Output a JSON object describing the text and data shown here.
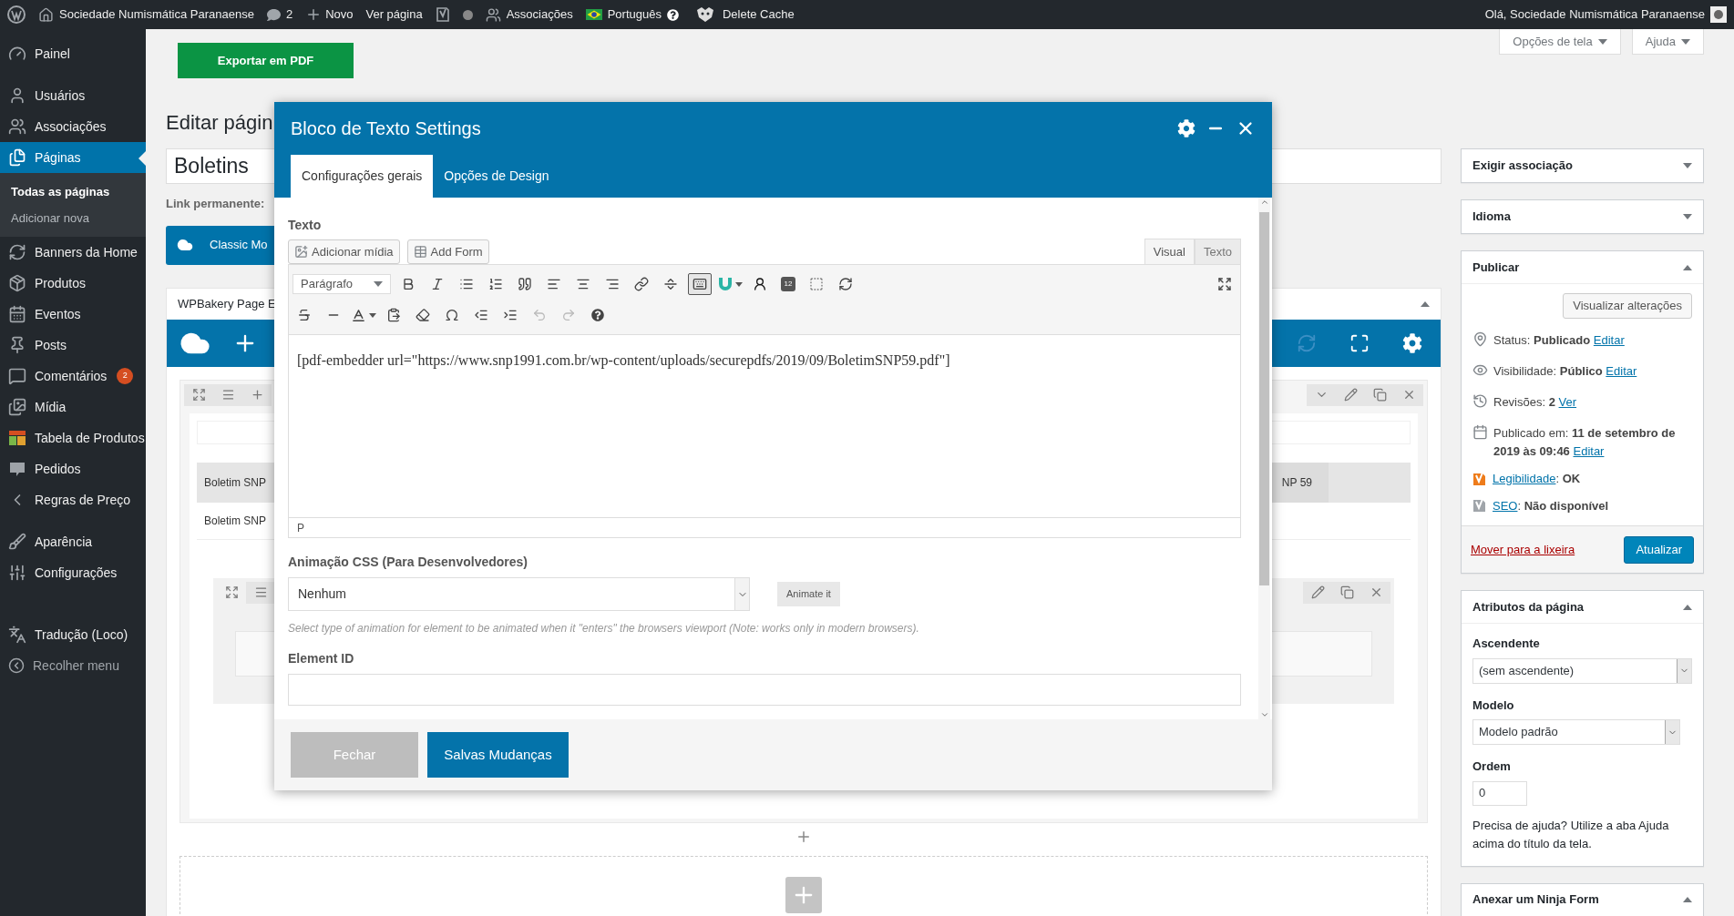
{
  "admin_bar": {
    "site": "Sociedade Numismática Paranaense",
    "comments": "2",
    "new": "Novo",
    "view": "Ver página",
    "associations": "Associações",
    "language": "Português",
    "cache": "Delete Cache",
    "greeting": "Olá, Sociedade Numismática Paranaense"
  },
  "screen_options": [
    "Opções de tela",
    "Ajuda"
  ],
  "sidebar": {
    "sections": [
      [
        {
          "label": "Painel",
          "selected": false
        }
      ],
      [
        {
          "label": "Usuários",
          "selected": false
        },
        {
          "label": "Associações",
          "selected": false
        },
        {
          "label": "Páginas",
          "selected": true,
          "children": [
            {
              "label": "Todas as páginas",
              "selected": true
            },
            {
              "label": "Adicionar nova",
              "selected": false
            }
          ]
        },
        {
          "label": "Banners da Home",
          "selected": false
        },
        {
          "label": "Produtos",
          "selected": false
        },
        {
          "label": "Eventos",
          "selected": false
        },
        {
          "label": "Posts",
          "selected": false
        },
        {
          "label": "Comentários",
          "selected": false,
          "badge": "2"
        },
        {
          "label": "Mídia",
          "selected": false
        },
        {
          "label": "Tabela de Produtos",
          "selected": false
        },
        {
          "label": "Pedidos",
          "selected": false
        },
        {
          "label": "Regras de Preço",
          "selected": false
        }
      ],
      [
        {
          "label": "Aparência",
          "selected": false
        },
        {
          "label": "Configurações",
          "selected": false
        }
      ],
      [
        {
          "label": "Tradução (Loco)",
          "selected": false
        }
      ]
    ],
    "collapse": "Recolher menu"
  },
  "export_button": "Exportar em PDF",
  "heading": "Editar págin",
  "title_field": {
    "value": "Boletins"
  },
  "permalink_label": "Link permanente:",
  "classic_button": "Classic Mo",
  "builder": {
    "title": "WPBakery Page E",
    "tab_row": [
      "Boletim SNP",
      "NP 59"
    ],
    "active_tab": "Boletim SNP"
  },
  "modal": {
    "title": "Bloco de Texto Settings",
    "tabs": [
      {
        "label": "Configurações gerais",
        "selected": true
      },
      {
        "label": "Opções de Design",
        "selected": false
      }
    ],
    "text_label": "Texto",
    "media_buttons": [
      "Adicionar mídia",
      "Add Form"
    ],
    "editor_tabs": [
      {
        "label": "Visual",
        "selected": true
      },
      {
        "label": "Texto",
        "selected": false
      }
    ],
    "format_select": "Parágrafo",
    "toolbar_toggle": {
      "on": true
    },
    "toolbar_badge": "12",
    "content": "[pdf-embedder url=\"https://www.snp1991.com.br/wp-content/uploads/securepdfs/2019/09/BoletimSNP59.pdf\"]",
    "path": "P",
    "animation": {
      "label": "Animação CSS (Para Desenvolvedores)",
      "value": "Nenhum",
      "button": "Animate it",
      "help": "Select type of animation for element to be animated when it \"enters\" the browsers viewport (Note: works only in modern browsers)."
    },
    "element_id": {
      "label": "Element ID"
    },
    "buttons": [
      {
        "label": "Fechar",
        "kind": "secondary"
      },
      {
        "label": "Salvas Mudanças",
        "kind": "primary"
      }
    ]
  },
  "boxes": [
    {
      "title": "Exigir associação",
      "expanded": false
    },
    {
      "title": "Idioma",
      "expanded": false
    },
    {
      "title": "Publicar",
      "expanded": true,
      "kind": "publish",
      "preview": "Visualizar alterações",
      "rows": [
        {
          "text": "Status: **Publicado**",
          "link": "Editar"
        },
        {
          "text": "Visibilidade: **Público**",
          "link": "Editar"
        },
        {
          "text": "Revisões: **2**",
          "link": "Ver"
        },
        {
          "text": "Publicado em: **11 de setembro de 2019 às 09:46**",
          "link": "Editar"
        }
      ],
      "seo": [
        {
          "link": "Legibilidade",
          "text": ": **OK**",
          "color": "#ee7c1b"
        },
        {
          "link": "SEO",
          "text": ": **Não disponível**",
          "color": "#a0a5aa"
        }
      ],
      "trash": "Mover para a lixeira",
      "update": "Atualizar"
    },
    {
      "title": "Atributos da página",
      "expanded": true,
      "kind": "attributes",
      "parent_label": "Ascendente",
      "parent": "(sem ascendente)",
      "template_label": "Modelo",
      "template": "Modelo padrão",
      "order_label": "Ordem",
      "order": "0",
      "help": "Precisa de ajuda? Utilize a aba Ajuda acima do título da tela."
    },
    {
      "title": "Anexar um Ninja Form",
      "expanded": true
    }
  ]
}
